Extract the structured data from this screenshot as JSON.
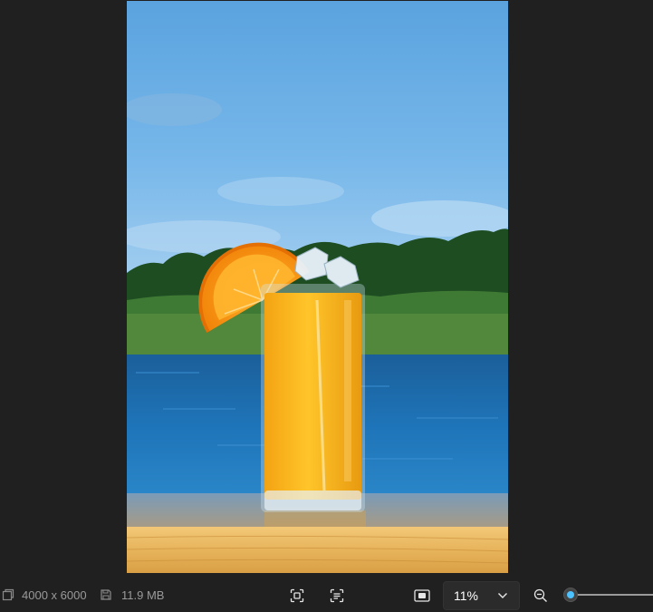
{
  "image": {
    "dimensions": "4000 x 6000",
    "file_size": "11.9 MB",
    "subject": "glass of orange juice with orange slice and ice on a wooden table by the sea"
  },
  "toolbar": {
    "dimensions_icon": "image-dimensions-icon",
    "file_size_icon": "save-disk-icon",
    "center_view_icon": "focus-frame-icon",
    "text_select_icon": "text-scan-icon",
    "actual_size_icon": "actual-size-icon",
    "zoom_out_icon": "zoom-out-icon"
  },
  "zoom": {
    "value": "11%",
    "level_fraction": 0.0
  },
  "colors": {
    "background": "#202020",
    "accent": "#4cc2ff",
    "text_muted": "#9a9a9a"
  }
}
